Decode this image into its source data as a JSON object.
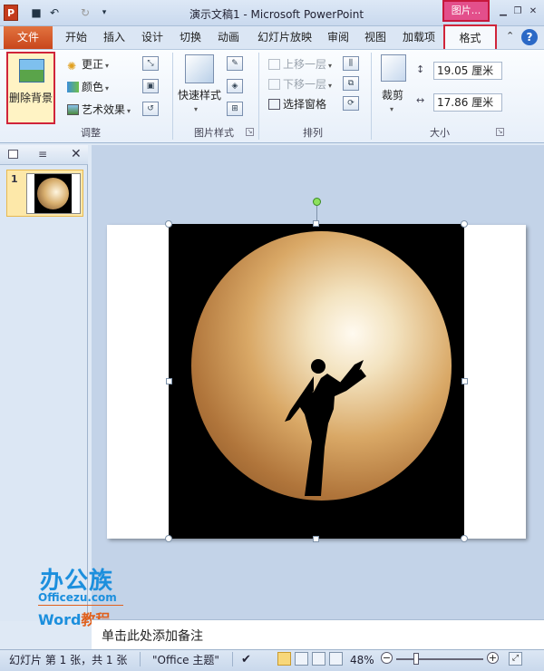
{
  "title_bar": {
    "app_icon": "P",
    "title": "演示文稿1 - Microsoft PowerPoint",
    "context_tab": "图片...",
    "quick_access": [
      "save-icon",
      "undo-icon",
      "redo-icon",
      "customize-icon"
    ]
  },
  "tabs": {
    "file": "文件",
    "items": [
      "开始",
      "插入",
      "设计",
      "切换",
      "动画",
      "幻灯片放映",
      "审阅",
      "视图",
      "加载项"
    ],
    "active": "格式"
  },
  "ribbon": {
    "adjust": {
      "remove_bg": "删除背景",
      "corrections": "更正",
      "color": "颜色",
      "artistic": "艺术效果",
      "label": "调整"
    },
    "styles": {
      "quick_styles": "快速样式",
      "label": "图片样式"
    },
    "arrange": {
      "bring_forward": "上移一层",
      "send_backward": "下移一层",
      "selection_pane": "选择窗格",
      "label": "排列"
    },
    "size": {
      "crop": "裁剪",
      "height": "19.05 厘米",
      "width": "17.86 厘米",
      "label": "大小"
    }
  },
  "slides_pane": {
    "slide_number": "1"
  },
  "notes": {
    "placeholder": "单击此处添加备注"
  },
  "watermark": {
    "brand": "办公族",
    "site": "Officezu.com",
    "word": "Word",
    "tutorial": "教程"
  },
  "status": {
    "slide_info": "幻灯片 第 1 张，共 1 张",
    "theme": "\"Office 主题\"",
    "zoom": "48%"
  }
}
